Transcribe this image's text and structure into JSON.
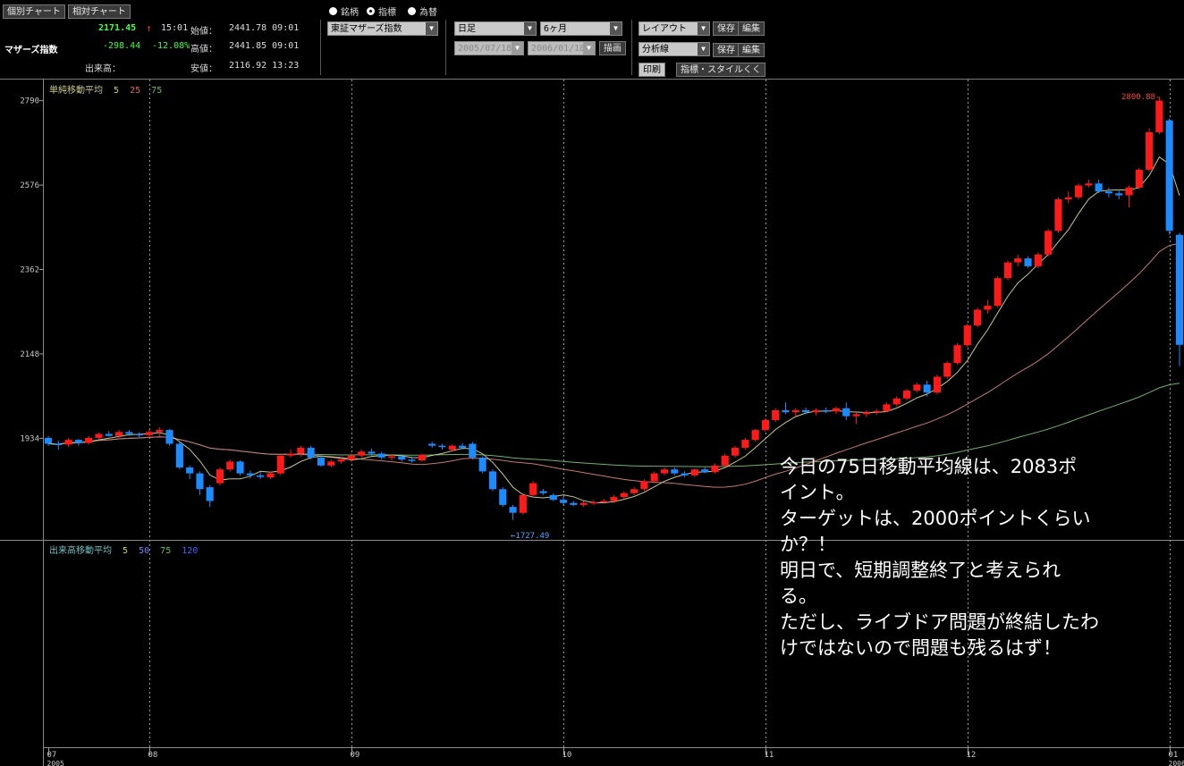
{
  "header": {
    "tabs": [
      {
        "label": "個別チャート",
        "active": true
      },
      {
        "label": "相対チャート",
        "active": false
      }
    ],
    "index_name": "マザーズ指数",
    "last_price": "2171.45",
    "last_time": "15:01",
    "change": "-298.44",
    "change_pct": "-12.08%",
    "volume_label": "出来高：",
    "open_label": "始値：",
    "open_value": "2441.78 09:01",
    "high_label": "高値：",
    "high_value": "2441.85 09:01",
    "low_label": "安値：",
    "low_value": "2116.92 13:23",
    "up_arrow_color": "#ff3030"
  },
  "controls": {
    "radios": [
      {
        "label": "銘柄",
        "selected": false
      },
      {
        "label": "指標",
        "selected": true
      },
      {
        "label": "為替",
        "selected": false
      }
    ],
    "symbol_select": "東証マザーズ指数",
    "period_select": "日足",
    "range_select": "6ヶ月",
    "date_from": "2005/07/18",
    "date_to": "2006/01/18",
    "draw_button": "描画",
    "layout_select": "レイアウト",
    "analysis_select": "分析線",
    "save_label": "保存",
    "edit_label": "編集",
    "print_button": "印刷",
    "style_button": "指標・スタイルくく"
  },
  "chart_data": {
    "type": "candlestick",
    "price_panel": {
      "legend_title": "単純移動平均",
      "legend_periods": [
        {
          "label": "5",
          "color": "#d0d060"
        },
        {
          "label": "25",
          "color": "#e06060"
        },
        {
          "label": "75",
          "color": "#60c060"
        }
      ],
      "y_ticks": [
        2790,
        2576,
        2362,
        2148,
        1934
      ],
      "ylim": [
        1690,
        2830
      ],
      "high_annotation": "2800.88-",
      "low_annotation": "←1727.49",
      "up_color": "#ff1a1a",
      "down_color": "#1a8cff",
      "ma_colors": {
        "ma5": "#c8c890",
        "ma25": "#c87878",
        "ma75": "#70b070"
      }
    },
    "volume_panel": {
      "legend_title": "出来高移動平均",
      "legend_periods": [
        {
          "label": "5",
          "color": "#d0d060"
        },
        {
          "label": "50",
          "color": "#8080ff"
        },
        {
          "label": "75",
          "color": "#60c060"
        },
        {
          "label": "120",
          "color": "#4060ff"
        }
      ]
    },
    "x_ticks": [
      {
        "label": "07",
        "index": 0,
        "year": "2005"
      },
      {
        "label": "08",
        "index": 10
      },
      {
        "label": "09",
        "index": 30
      },
      {
        "label": "10",
        "index": 51
      },
      {
        "label": "11",
        "index": 71
      },
      {
        "label": "12",
        "index": 91
      },
      {
        "label": "01",
        "index": 111,
        "year": "2006"
      }
    ],
    "candles": [
      [
        1935,
        1940,
        1915,
        1920
      ],
      [
        1920,
        1928,
        1905,
        1918
      ],
      [
        1918,
        1935,
        1912,
        1930
      ],
      [
        1930,
        1932,
        1915,
        1922
      ],
      [
        1922,
        1940,
        1918,
        1935
      ],
      [
        1935,
        1948,
        1930,
        1945
      ],
      [
        1945,
        1952,
        1938,
        1940
      ],
      [
        1940,
        1955,
        1935,
        1950
      ],
      [
        1950,
        1955,
        1940,
        1945
      ],
      [
        1945,
        1950,
        1935,
        1942
      ],
      [
        1942,
        1958,
        1936,
        1950
      ],
      [
        1950,
        1962,
        1938,
        1955
      ],
      [
        1955,
        1958,
        1915,
        1920
      ],
      [
        1920,
        1925,
        1855,
        1860
      ],
      [
        1860,
        1865,
        1830,
        1845
      ],
      [
        1845,
        1850,
        1790,
        1805
      ],
      [
        1810,
        1815,
        1760,
        1775
      ],
      [
        1820,
        1860,
        1815,
        1855
      ],
      [
        1855,
        1880,
        1850,
        1875
      ],
      [
        1875,
        1878,
        1840,
        1845
      ],
      [
        1845,
        1852,
        1832,
        1840
      ],
      [
        1840,
        1848,
        1830,
        1836
      ],
      [
        1835,
        1850,
        1830,
        1845
      ],
      [
        1845,
        1895,
        1840,
        1890
      ],
      [
        1890,
        1905,
        1885,
        1895
      ],
      [
        1895,
        1915,
        1888,
        1910
      ],
      [
        1910,
        1915,
        1880,
        1885
      ],
      [
        1885,
        1888,
        1862,
        1865
      ],
      [
        1865,
        1880,
        1860,
        1875
      ],
      [
        1875,
        1885,
        1870,
        1880
      ],
      [
        1880,
        1895,
        1875,
        1890
      ],
      [
        1890,
        1905,
        1885,
        1900
      ],
      [
        1900,
        1908,
        1890,
        1895
      ],
      [
        1895,
        1900,
        1880,
        1885
      ],
      [
        1885,
        1892,
        1878,
        1888
      ],
      [
        1888,
        1892,
        1875,
        1880
      ],
      [
        1880,
        1888,
        1872,
        1878
      ],
      [
        1878,
        1895,
        1875,
        1892
      ],
      [
        1920,
        1925,
        1910,
        1915
      ],
      [
        1915,
        1920,
        1905,
        1912
      ],
      [
        1905,
        1918,
        1900,
        1915
      ],
      [
        1915,
        1922,
        1905,
        1910
      ],
      [
        1920,
        1925,
        1880,
        1885
      ],
      [
        1885,
        1888,
        1845,
        1850
      ],
      [
        1850,
        1855,
        1800,
        1805
      ],
      [
        1805,
        1810,
        1760,
        1765
      ],
      [
        1760,
        1765,
        1727,
        1745
      ],
      [
        1745,
        1795,
        1740,
        1790
      ],
      [
        1790,
        1825,
        1785,
        1820
      ],
      [
        1800,
        1805,
        1790,
        1795
      ],
      [
        1790,
        1795,
        1775,
        1778
      ],
      [
        1778,
        1785,
        1765,
        1770
      ],
      [
        1770,
        1775,
        1762,
        1765
      ],
      [
        1765,
        1775,
        1760,
        1770
      ],
      [
        1770,
        1778,
        1765,
        1772
      ],
      [
        1772,
        1780,
        1768,
        1775
      ],
      [
        1775,
        1790,
        1770,
        1785
      ],
      [
        1785,
        1800,
        1780,
        1795
      ],
      [
        1795,
        1810,
        1790,
        1805
      ],
      [
        1805,
        1830,
        1800,
        1825
      ],
      [
        1825,
        1850,
        1820,
        1845
      ],
      [
        1845,
        1860,
        1840,
        1855
      ],
      [
        1855,
        1860,
        1840,
        1845
      ],
      [
        1845,
        1850,
        1835,
        1840
      ],
      [
        1840,
        1858,
        1836,
        1855
      ],
      [
        1855,
        1860,
        1845,
        1848
      ],
      [
        1848,
        1870,
        1845,
        1865
      ],
      [
        1865,
        1895,
        1860,
        1890
      ],
      [
        1890,
        1915,
        1885,
        1910
      ],
      [
        1910,
        1935,
        1905,
        1930
      ],
      [
        1930,
        1958,
        1925,
        1955
      ],
      [
        1955,
        1985,
        1950,
        1980
      ],
      [
        1980,
        2010,
        1975,
        2005
      ],
      [
        2005,
        2025,
        1995,
        2000
      ],
      [
        2000,
        2010,
        1990,
        2005
      ],
      [
        2005,
        2012,
        1995,
        2000
      ],
      [
        2000,
        2010,
        1992,
        2005
      ],
      [
        2005,
        2012,
        1998,
        2002
      ],
      [
        2002,
        2015,
        1996,
        2010
      ],
      [
        2010,
        2025,
        1980,
        1990
      ],
      [
        1990,
        2000,
        1970,
        1995
      ],
      [
        1995,
        2005,
        1988,
        2000
      ],
      [
        2000,
        2008,
        1993,
        2003
      ],
      [
        2003,
        2025,
        2000,
        2020
      ],
      [
        2020,
        2040,
        2015,
        2035
      ],
      [
        2035,
        2060,
        2030,
        2055
      ],
      [
        2055,
        2075,
        2050,
        2070
      ],
      [
        2070,
        2080,
        2040,
        2050
      ],
      [
        2050,
        2095,
        2045,
        2090
      ],
      [
        2090,
        2130,
        2085,
        2125
      ],
      [
        2125,
        2175,
        2120,
        2170
      ],
      [
        2170,
        2225,
        2165,
        2220
      ],
      [
        2220,
        2265,
        2215,
        2260
      ],
      [
        2260,
        2285,
        2250,
        2270
      ],
      [
        2270,
        2345,
        2265,
        2340
      ],
      [
        2340,
        2385,
        2335,
        2380
      ],
      [
        2380,
        2400,
        2370,
        2390
      ],
      [
        2390,
        2395,
        2365,
        2370
      ],
      [
        2370,
        2405,
        2365,
        2400
      ],
      [
        2400,
        2465,
        2395,
        2460
      ],
      [
        2460,
        2545,
        2455,
        2540
      ],
      [
        2540,
        2560,
        2530,
        2545
      ],
      [
        2545,
        2580,
        2540,
        2575
      ],
      [
        2575,
        2590,
        2570,
        2580
      ],
      [
        2580,
        2590,
        2555,
        2560
      ],
      [
        2560,
        2570,
        2545,
        2555
      ],
      [
        2555,
        2565,
        2540,
        2550
      ],
      [
        2550,
        2575,
        2520,
        2570
      ],
      [
        2570,
        2620,
        2565,
        2615
      ],
      [
        2615,
        2720,
        2610,
        2710
      ],
      [
        2710,
        2800,
        2705,
        2790
      ],
      [
        2740,
        2745,
        2450,
        2460
      ],
      [
        2450,
        2455,
        2117,
        2171
      ]
    ]
  },
  "comment": {
    "lines": [
      "今日の75日移動平均線は、2083ポ",
      "イント。",
      "ターゲットは、2000ポイントくらい",
      "か？！",
      "明日で、短期調整終了と考えられ",
      "る。",
      "ただし、ライブドア問題が終結したわ",
      "けではないので問題も残るはず！"
    ]
  }
}
